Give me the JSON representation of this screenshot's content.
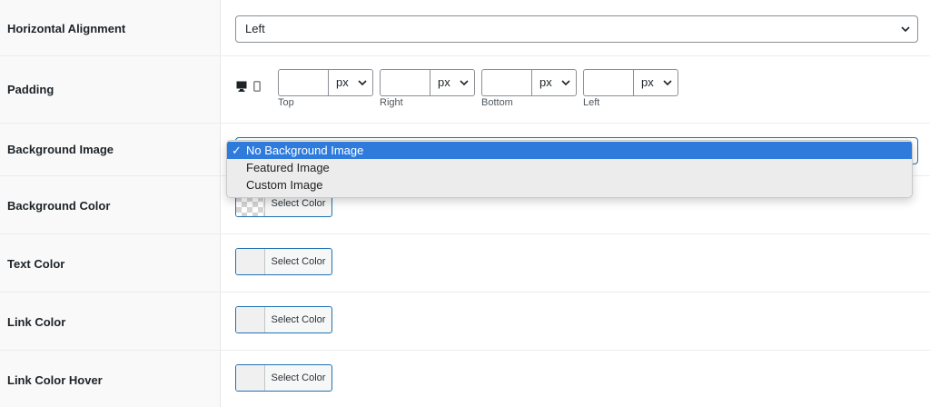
{
  "rows": {
    "horizontal_alignment": {
      "label": "Horizontal Alignment",
      "value": "Left"
    },
    "padding": {
      "label": "Padding",
      "fields": [
        {
          "unit": "px",
          "caption": "Top"
        },
        {
          "unit": "px",
          "caption": "Right"
        },
        {
          "unit": "px",
          "caption": "Bottom"
        },
        {
          "unit": "px",
          "caption": "Left"
        }
      ]
    },
    "background_image": {
      "label": "Background Image",
      "value": "No Background Image",
      "options": [
        "No Background Image",
        "Featured Image",
        "Custom Image"
      ],
      "check": "✓"
    },
    "background_color": {
      "label": "Background Color",
      "button": "Select Color"
    },
    "text_color": {
      "label": "Text Color",
      "button": "Select Color"
    },
    "link_color": {
      "label": "Link Color",
      "button": "Select Color"
    },
    "link_color_hover": {
      "label": "Link Color Hover",
      "button": "Select Color"
    }
  },
  "icons": {
    "desktop": "desktop-icon",
    "mobile": "mobile-icon",
    "chevron": "chevron-down-icon"
  },
  "colors": {
    "accent": "#2271b1",
    "selected_option": "#2e7bdc",
    "border": "#8c8f94"
  }
}
